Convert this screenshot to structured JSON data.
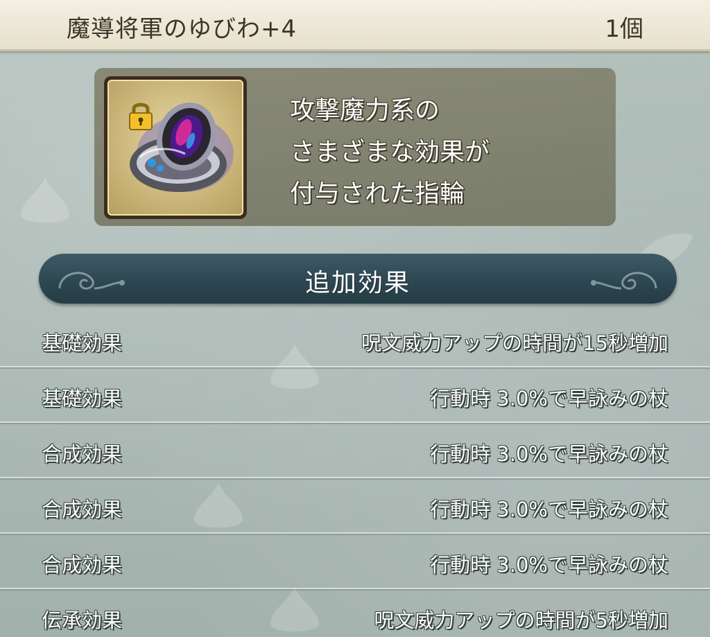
{
  "header": {
    "item_name": "魔導将軍のゆびわ+4",
    "count": "1個"
  },
  "item": {
    "icon": "ring-icon",
    "lock_icon": "padlock-icon",
    "description": [
      "攻撃魔力系の",
      "さまざまな効果が",
      "付与された指輪"
    ]
  },
  "section": {
    "title": "追加効果"
  },
  "effects": [
    {
      "label": "基礎効果",
      "value": "呪文威力アップの時間が15秒増加"
    },
    {
      "label": "基礎効果",
      "value": "行動時 3.0%で早詠みの杖"
    },
    {
      "label": "合成効果",
      "value": "行動時 3.0%で早詠みの杖"
    },
    {
      "label": "合成効果",
      "value": "行動時 3.0%で早詠みの杖"
    },
    {
      "label": "合成効果",
      "value": "行動時 3.0%で早詠みの杖"
    },
    {
      "label": "伝承効果",
      "value": "呪文威力アップの時間が5秒増加"
    }
  ],
  "colors": {
    "title_bar": "#ece7d6",
    "section_header": "#2d4852",
    "card": "#767559",
    "background": "#a9b7b3"
  }
}
